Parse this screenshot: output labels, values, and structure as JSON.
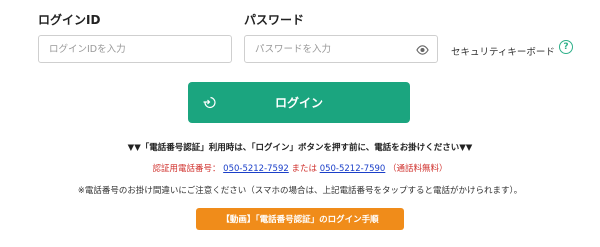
{
  "login_id": {
    "label": "ログインID",
    "placeholder": "ログインIDを入力",
    "value": ""
  },
  "password": {
    "label": "パスワード",
    "placeholder": "パスワードを入力",
    "value": "",
    "toggle_icon": "eye-icon"
  },
  "security_keyboard": {
    "label": "セキュリティキーボード",
    "help_icon": "?"
  },
  "login_button": {
    "label": "ログイン",
    "icon": "login-icon"
  },
  "notices": {
    "line1": "▼▼「電話番号認証」利用時は、「ログイン」ボタンを押す前に、電話をお掛けください▼▼",
    "line2_prefix": "認証用電話番号：",
    "phone1": "050-5212-7592",
    "line2_or": "または",
    "phone2": "050-5212-7590",
    "line2_suffix": "（通話料無料）",
    "line3": "※電話番号のお掛け間違いにご注意ください（スマホの場合は、上記電話番号をタップすると電話がかけられます）。"
  },
  "video_button": {
    "label": "【動画】「電話番号認証」のログイン手順"
  },
  "colors": {
    "primary_green": "#1ba57f",
    "help_green": "#2fb08a",
    "alert_red": "#d0312d",
    "link_blue": "#1a3fc9",
    "video_orange": "#f08c1a"
  }
}
